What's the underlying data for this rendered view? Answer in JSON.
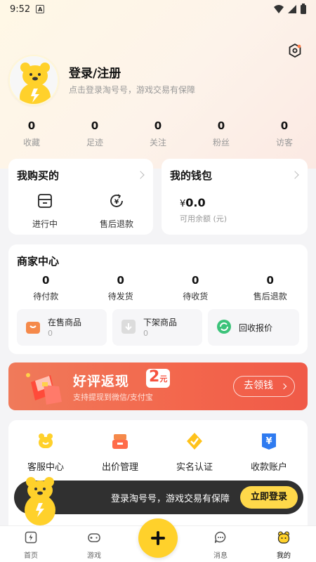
{
  "status_bar": {
    "time": "9:52"
  },
  "profile": {
    "title": "登录/注册",
    "subtitle": "点击登录淘号号，游戏交易有保障"
  },
  "stats": [
    {
      "value": "0",
      "label": "收藏"
    },
    {
      "value": "0",
      "label": "足迹"
    },
    {
      "value": "0",
      "label": "关注"
    },
    {
      "value": "0",
      "label": "粉丝"
    },
    {
      "value": "0",
      "label": "访客"
    }
  ],
  "purchases": {
    "title": "我购买的",
    "items": [
      {
        "label": "进行中",
        "icon": "box-icon"
      },
      {
        "label": "售后退款",
        "icon": "refund-icon"
      }
    ]
  },
  "wallet": {
    "title": "我的钱包",
    "currency": "¥",
    "amount": "0.0",
    "sublabel": "可用余额 (元)"
  },
  "merchant": {
    "title": "商家中心",
    "stats": [
      {
        "value": "0",
        "label": "待付款"
      },
      {
        "value": "0",
        "label": "待发货"
      },
      {
        "value": "0",
        "label": "待收货"
      },
      {
        "value": "0",
        "label": "售后退款"
      }
    ],
    "tiles": [
      {
        "label": "在售商品",
        "count": "0",
        "color": "#f5894a"
      },
      {
        "label": "下架商品",
        "count": "0",
        "color": "#dddddd"
      },
      {
        "label": "回收报价",
        "count": "",
        "color": "#3cc37a"
      }
    ]
  },
  "banner": {
    "title": "好评返现",
    "amount": "2",
    "unit": "元",
    "subtitle": "支持提现到微信/支付宝",
    "button": "去领钱"
  },
  "services": [
    {
      "label": "客服中心",
      "icon": "service-bear-icon"
    },
    {
      "label": "出价管理",
      "icon": "bid-icon"
    },
    {
      "label": "实名认证",
      "icon": "verify-icon"
    },
    {
      "label": "收款账户",
      "icon": "wallet-account-icon"
    }
  ],
  "toast": {
    "text": "登录淘号号，游戏交易有保障",
    "button": "立即登录"
  },
  "tabs": [
    {
      "label": "首页",
      "icon": "home-icon"
    },
    {
      "label": "游戏",
      "icon": "gamepad-icon"
    },
    {
      "label": "消息",
      "icon": "message-icon"
    },
    {
      "label": "我的",
      "icon": "bear-icon"
    }
  ],
  "colors": {
    "accent_yellow": "#ffd12b",
    "banner_red": "#f3664c",
    "toast_bg": "#1e1e1e"
  }
}
